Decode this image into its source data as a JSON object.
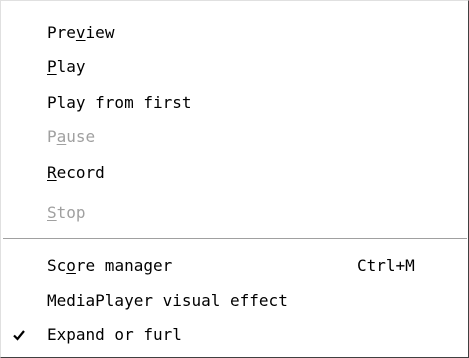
{
  "menu": {
    "items": [
      {
        "pre": "Pre",
        "u": "v",
        "post": "iew",
        "shortcut": "",
        "disabled": false,
        "checked": false
      },
      {
        "pre": "",
        "u": "P",
        "post": "lay",
        "shortcut": "",
        "disabled": false,
        "checked": false
      },
      {
        "pre": "Play from first",
        "u": "",
        "post": "",
        "shortcut": "",
        "disabled": false,
        "checked": false
      },
      {
        "pre": "P",
        "u": "a",
        "post": "use",
        "shortcut": "",
        "disabled": true,
        "checked": false
      },
      {
        "pre": "",
        "u": "R",
        "post": "ecord",
        "shortcut": "",
        "disabled": false,
        "checked": false
      },
      {
        "pre": "",
        "u": "S",
        "post": "top",
        "shortcut": "",
        "disabled": true,
        "checked": false
      },
      {
        "pre": "Sc",
        "u": "o",
        "post": "re manager",
        "shortcut": "Ctrl+M",
        "disabled": false,
        "checked": false
      },
      {
        "pre": "MediaPlayer visual effect",
        "u": "",
        "post": "",
        "shortcut": "",
        "disabled": false,
        "checked": false
      },
      {
        "pre": "Expand or furl",
        "u": "",
        "post": "",
        "shortcut": "",
        "disabled": false,
        "checked": true
      }
    ],
    "check_icon": "checkmark-icon",
    "colors": {
      "text": "#000000",
      "disabled_text": "#a0a0a0",
      "separator": "#a0a0a0",
      "background": "#ffffff"
    }
  }
}
